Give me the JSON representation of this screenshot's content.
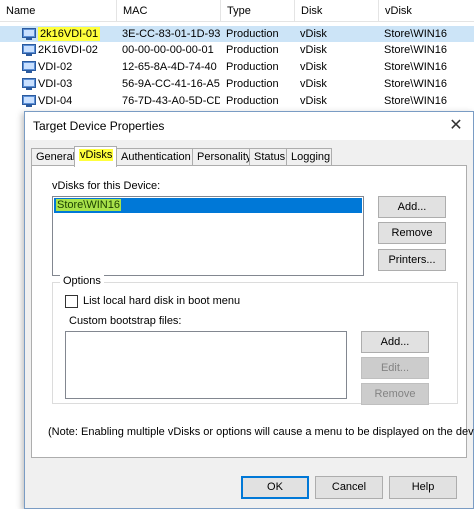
{
  "table": {
    "columns": [
      "Name",
      "MAC",
      "Type",
      "Disk",
      "vDisk"
    ],
    "rows": [
      {
        "name": "2k16VDI-01",
        "mac": "3E-CC-83-01-1D-93",
        "type": "Production",
        "disk": "vDisk",
        "vdisk": "Store\\WIN16",
        "selected": true
      },
      {
        "name": "2K16VDI-02",
        "mac": "00-00-00-00-00-01",
        "type": "Production",
        "disk": "vDisk",
        "vdisk": "Store\\WIN16"
      },
      {
        "name": "VDI-02",
        "mac": "12-65-8A-4D-74-40",
        "type": "Production",
        "disk": "vDisk",
        "vdisk": "Store\\WIN16"
      },
      {
        "name": "VDI-03",
        "mac": "56-9A-CC-41-16-A5",
        "type": "Production",
        "disk": "vDisk",
        "vdisk": "Store\\WIN16"
      },
      {
        "name": "VDI-04",
        "mac": "76-7D-43-A0-5D-CD",
        "type": "Production",
        "disk": "vDisk",
        "vdisk": "Store\\WIN16"
      }
    ]
  },
  "dialog": {
    "title": "Target Device Properties",
    "close": "✕",
    "tabs": [
      "General",
      "vDisks",
      "Authentication",
      "Personality",
      "Status",
      "Logging"
    ],
    "active_tab": "vDisks",
    "vdisks_label": "vDisks for this Device:",
    "vdisk_items": [
      "Store\\WIN16"
    ],
    "buttons": {
      "add": "Add...",
      "remove": "Remove",
      "printers": "Printers..."
    },
    "options": {
      "legend": "Options",
      "checkbox_label": "List local hard disk in boot menu",
      "checkbox_checked": false,
      "bootstrap_label": "Custom bootstrap files:",
      "add": "Add...",
      "edit": "Edit...",
      "remove": "Remove"
    },
    "note": "(Note: Enabling multiple vDisks or options will cause a menu to be displayed on the device.)",
    "footer": {
      "ok": "OK",
      "cancel": "Cancel",
      "help": "Help"
    }
  },
  "colors": {
    "highlight": "#ffff3c",
    "selection": "#0078d7"
  }
}
